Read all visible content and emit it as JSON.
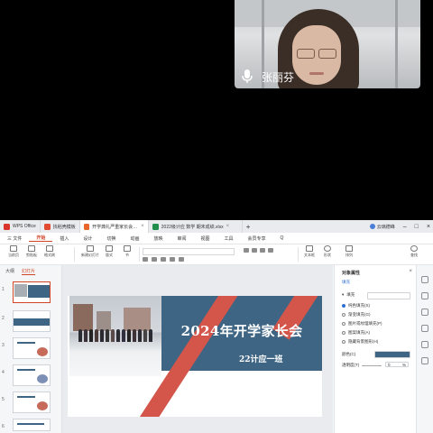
{
  "webcam": {
    "speaker_name": "张丽芬",
    "icon": "microphone-icon"
  },
  "wps": {
    "tabs": [
      {
        "label": "WPS Office",
        "color": "#d9342b"
      },
      {
        "label": "找稻壳模板",
        "color": "#e2492f"
      },
      {
        "label": "开学典礼严重家长会.pptx",
        "color": "#e8652c",
        "active": true
      },
      {
        "label": "2022级计应 数学 期末成绩.xlsx",
        "color": "#1f8f4e"
      }
    ],
    "new_tab": "+",
    "user": "云璃德峰",
    "menu": [
      "三 文件",
      "开始",
      "插入",
      "设计",
      "切换",
      "动画",
      "放映",
      "审阅",
      "视图",
      "工具",
      "会员专享"
    ],
    "menu_active": "开始",
    "search": "Q",
    "ribbon": [
      "当前页",
      "剪贴板",
      "格式刷",
      "新建幻灯片",
      "版式",
      "节",
      "文本框",
      "形状",
      "排列",
      "查找",
      "选择"
    ],
    "thumb_panel": {
      "tabs": [
        "大纲",
        "幻灯片"
      ],
      "active": "幻灯片",
      "numbers": [
        "1",
        "2",
        "3",
        "4",
        "5",
        "6"
      ]
    },
    "slide": {
      "title": "2024年开学家长会",
      "subtitle": "22计应一班"
    },
    "pane": {
      "title": "对象属性",
      "section": "填充",
      "subsection": "填充",
      "dropdown": "",
      "options": [
        "纯色填充(S)",
        "渐变填充(G)",
        "图片或纹理填充(P)",
        "图案填充(A)",
        "隐藏背景图形(H)"
      ],
      "selected": 0,
      "color_label": "颜色(C)",
      "transparency_label": "透明度(T)",
      "transparency_value": "0",
      "transparency_unit": "%"
    }
  }
}
